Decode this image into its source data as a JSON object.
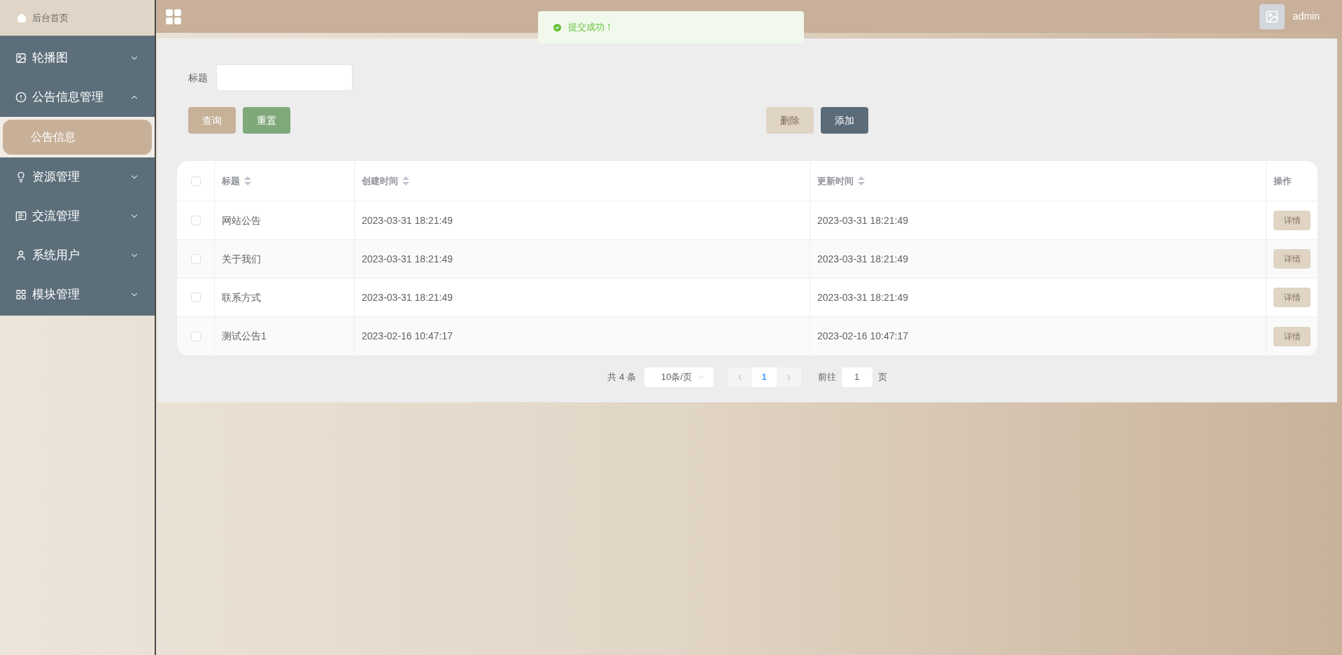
{
  "sidebar": {
    "home": {
      "label": "后台首页"
    },
    "menu": [
      {
        "label": "轮播图",
        "expanded": false
      },
      {
        "label": "公告信息管理",
        "expanded": true,
        "children": [
          {
            "label": "公告信息",
            "selected": true
          }
        ]
      },
      {
        "label": "资源管理",
        "expanded": false
      },
      {
        "label": "交流管理",
        "expanded": false
      },
      {
        "label": "系统用户",
        "expanded": false
      },
      {
        "label": "模块管理",
        "expanded": false
      }
    ]
  },
  "topbar": {
    "user": "admin"
  },
  "toast": {
    "message": "提交成功！"
  },
  "search": {
    "label": "标题"
  },
  "buttons": [
    {
      "label": "查询",
      "kind": "query",
      "disabled": false
    },
    {
      "label": "重置",
      "kind": "reset",
      "disabled": false
    },
    {
      "label": "删除",
      "kind": "delete",
      "disabled": true
    },
    {
      "label": "添加",
      "kind": "add",
      "disabled": false
    }
  ],
  "table": {
    "select_all_checked": false,
    "columns": [
      {
        "label": "标题",
        "sortable": true
      },
      {
        "label": "创建时间",
        "sortable": true
      },
      {
        "label": "更新时间",
        "sortable": true
      },
      {
        "label": "操作",
        "sortable": false
      }
    ],
    "rows": [
      {
        "checked": false,
        "cells": [
          "网站公告",
          "2023-03-31 18:21:49",
          "2023-03-31 18:21:49"
        ],
        "action": "详情"
      },
      {
        "checked": false,
        "cells": [
          "关于我们",
          "2023-03-31 18:21:49",
          "2023-03-31 18:21:49"
        ],
        "action": "详情"
      },
      {
        "checked": false,
        "cells": [
          "联系方式",
          "2023-03-31 18:21:49",
          "2023-03-31 18:21:49"
        ],
        "action": "详情"
      },
      {
        "checked": false,
        "cells": [
          "测试公告1",
          "2023-02-16 10:47:17",
          "2023-02-16 10:47:17"
        ],
        "action": "详情"
      }
    ]
  },
  "pagination": {
    "total": "共 4 条",
    "page_size": "10条/页",
    "pages": [
      {
        "label": "1",
        "selected": true
      }
    ],
    "goto_label": "前往",
    "goto_value": "1",
    "goto_suffix": "页"
  }
}
